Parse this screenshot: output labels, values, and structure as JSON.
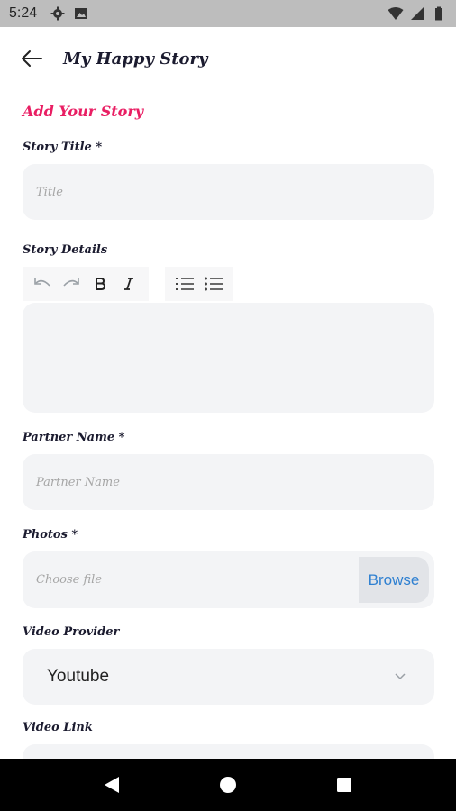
{
  "status_bar": {
    "time": "5:24"
  },
  "app_bar": {
    "title": "My Happy Story"
  },
  "form": {
    "section_title": "Add Your Story",
    "story_title": {
      "label": "Story Title *",
      "placeholder": "Title"
    },
    "story_details": {
      "label": "Story Details"
    },
    "partner_name": {
      "label": "Partner Name *",
      "placeholder": "Partner Name"
    },
    "photos": {
      "label": "Photos *",
      "placeholder": "Choose file",
      "browse_label": "Browse"
    },
    "video_provider": {
      "label": "Video Provider",
      "selected": "Youtube"
    },
    "video_link": {
      "label": "Video Link"
    }
  },
  "colors": {
    "accent": "#e91e63",
    "field_bg": "#f3f4f6",
    "browse_text": "#2f80d1"
  }
}
